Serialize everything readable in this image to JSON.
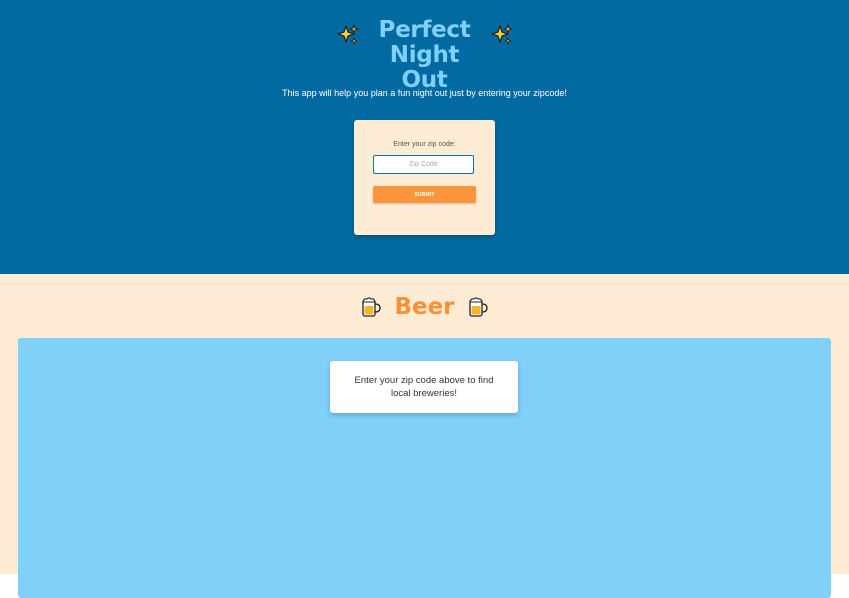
{
  "hero": {
    "title": "Perfect Night Out",
    "title_icon_left": "sparkles-icon",
    "title_icon_right": "sparkles-icon",
    "subtitle": "This app will help you plan a fun night out just by entering your zipcode!",
    "background_color": "#036aa1",
    "title_color": "#80d0fa"
  },
  "zip_form": {
    "label": "Enter your zip code:",
    "input_value": "",
    "input_placeholder": "Zip Code",
    "submit_label": "SUBMIT",
    "card_color": "#feecd5",
    "button_color": "#fb953b"
  },
  "beer_section": {
    "title": "Beer",
    "title_icon_left": "beer-mug-icon",
    "title_icon_right": "beer-mug-icon",
    "title_color": "#f98f36",
    "background_color": "#feebd4",
    "panel_color": "#80d0fa",
    "message": "Enter your zip code above to find local breweries!"
  }
}
